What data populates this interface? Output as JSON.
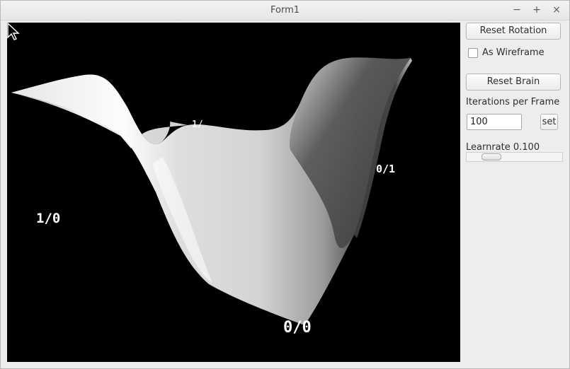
{
  "window": {
    "title": "Form1",
    "minimize_glyph": "−",
    "maximize_glyph": "+",
    "close_glyph": "×"
  },
  "viewport": {
    "corner_labels": {
      "one_zero": "1/0",
      "zero_one": "0/1",
      "zero_zero": "0/0",
      "one_one": "1/"
    }
  },
  "controls": {
    "reset_rotation_label": "Reset Rotation",
    "wireframe_label": "As Wireframe",
    "wireframe_checked": false,
    "reset_brain_label": "Reset Brain",
    "iterations_label": "Iterations per Frame",
    "iterations_value": "100",
    "set_label": "set",
    "learnrate_label": "Learnrate 0.100",
    "learnrate_value": 0.1,
    "learnrate_slider_position": 0.2
  },
  "icons": {
    "cursor": "mouse-pointer-icon"
  },
  "colors": {
    "viewport_background": "#000000",
    "surface_light": "#f2f2f2",
    "surface_dark": "#3a3a3a"
  }
}
